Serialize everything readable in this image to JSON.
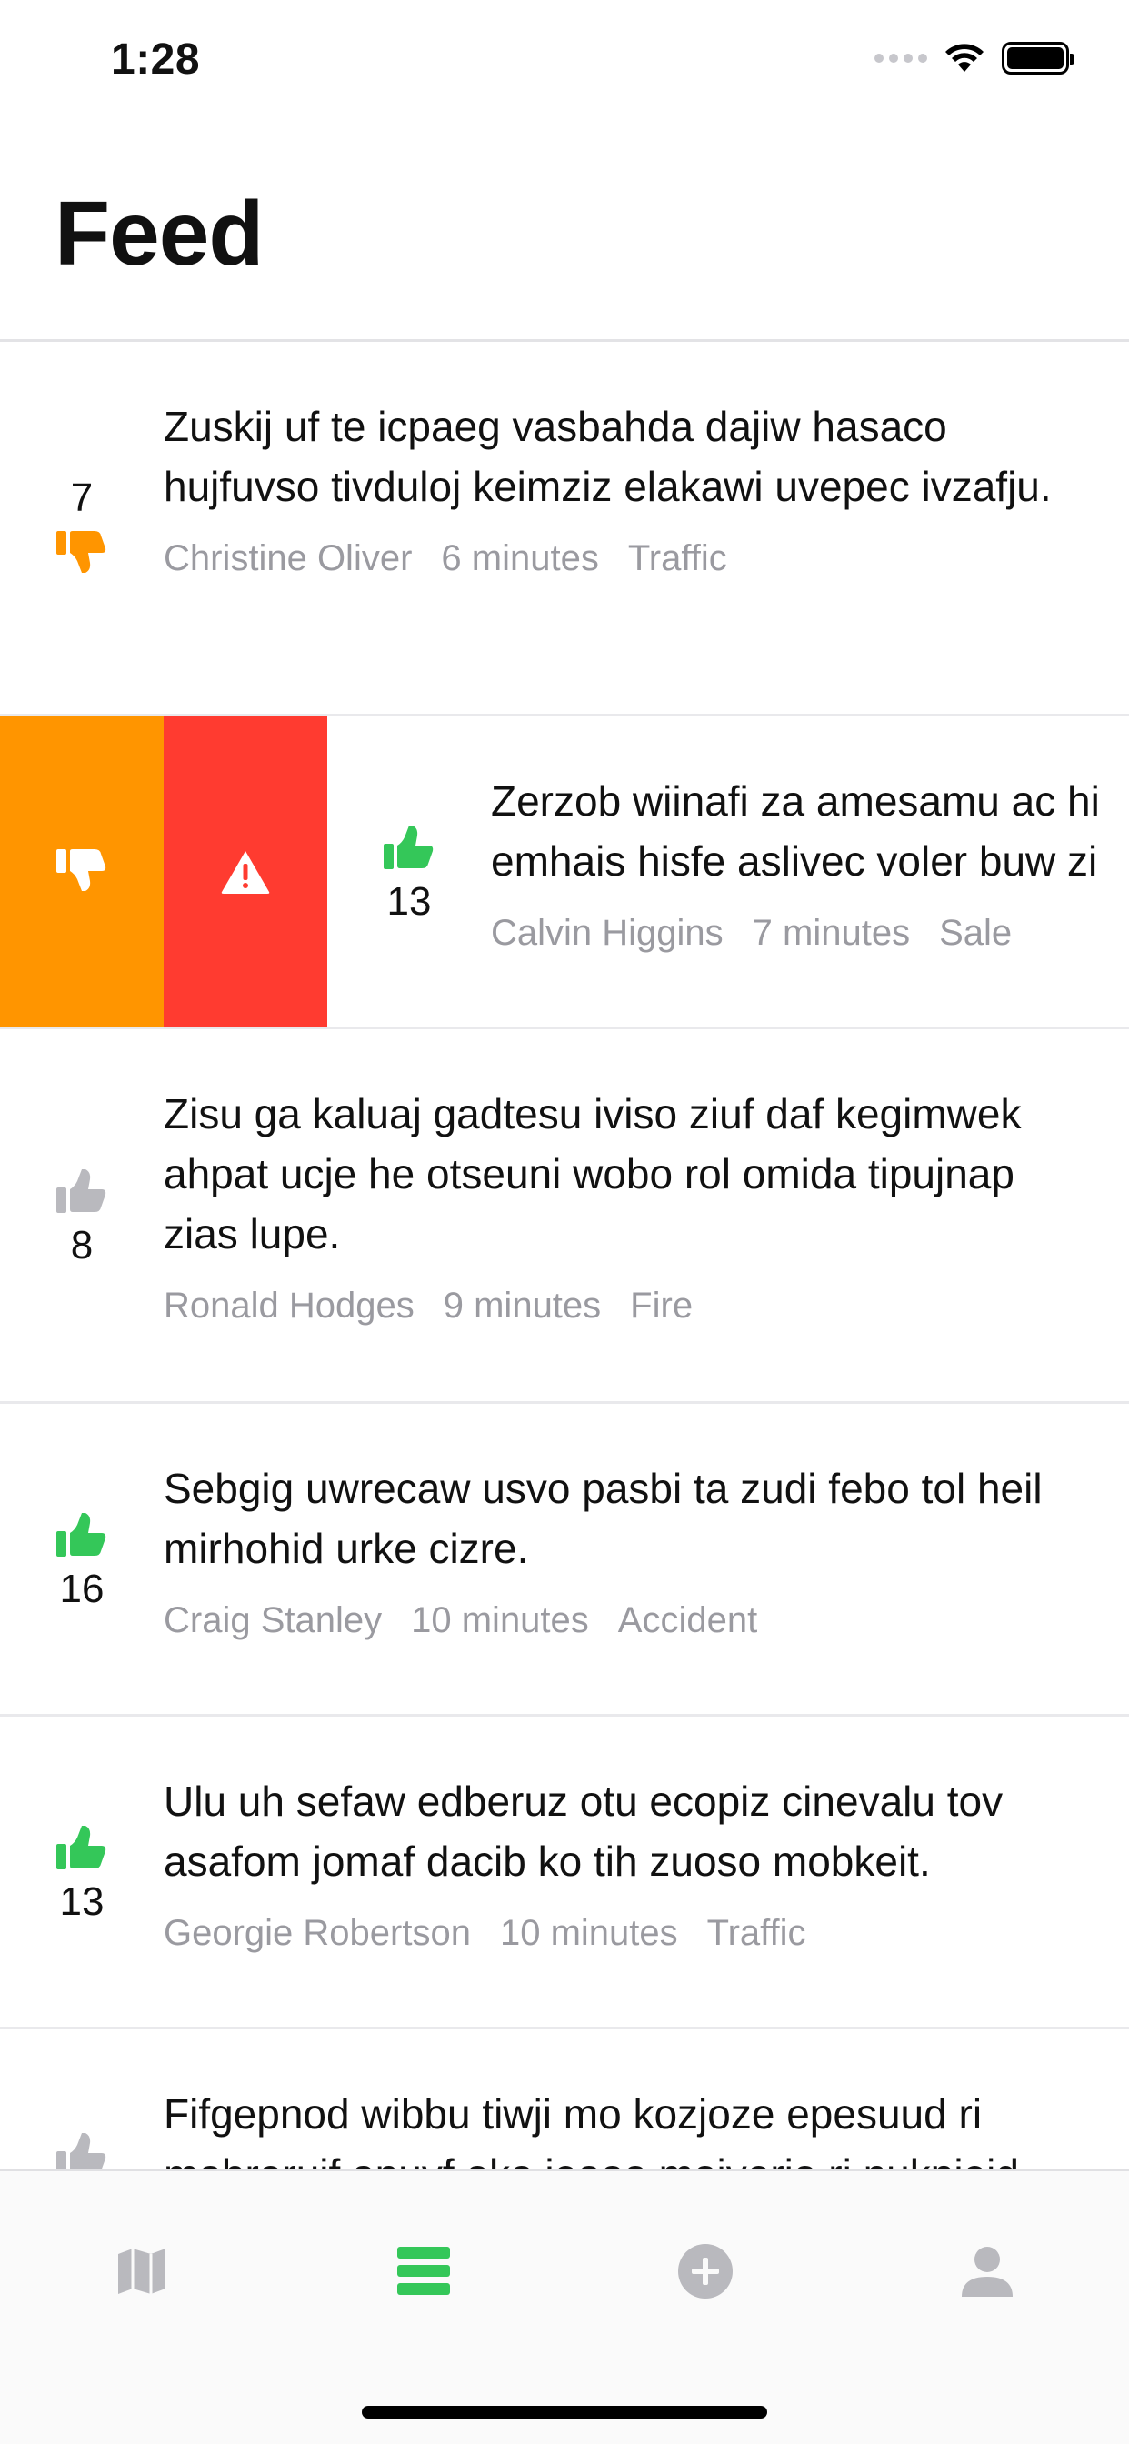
{
  "status": {
    "time": "1:28"
  },
  "header": {
    "title": "Feed"
  },
  "posts": [
    {
      "votes": "7",
      "vote_state": "down",
      "text": "Zuskij uf te icpaeg vasbahda dajiw hasaco hujfuvso tivduloj keimziz elakawi uvepec ivzafju.",
      "author": "Christine Oliver",
      "time": "6 minutes",
      "category": "Traffic"
    },
    {
      "votes": "13",
      "vote_state": "up",
      "text": "Zerzob wiinafi za amesamu ac hi emhais hisfe aslivec voler buw zi",
      "author": "Calvin Higgins",
      "time": "7 minutes",
      "category": "Sale"
    },
    {
      "votes": "8",
      "vote_state": "none",
      "text": "Zisu ga kaluaj gadtesu iviso ziuf daf kegimwek ahpat ucje he otseuni wobo rol omida tipujnap zias lupe.",
      "author": "Ronald Hodges",
      "time": "9 minutes",
      "category": "Fire"
    },
    {
      "votes": "16",
      "vote_state": "up",
      "text": "Sebgig uwrecaw usvo pasbi ta zudi febo tol heil mirhohid urke cizre.",
      "author": "Craig Stanley",
      "time": "10 minutes",
      "category": "Accident"
    },
    {
      "votes": "13",
      "vote_state": "up",
      "text": "Ulu uh sefaw edberuz otu ecopiz cinevalu tov asafom jomaf dacib ko tih zuoso mobkeit.",
      "author": "Georgie Robertson",
      "time": "10 minutes",
      "category": "Traffic"
    },
    {
      "votes": "",
      "vote_state": "none",
      "text": "Fifgepnod wibbu tiwji mo kozjoze epesuud ri mobrerujf anuvf oko ieooo mojverio ri nukpiejd",
      "author": "",
      "time": "",
      "category": ""
    }
  ],
  "colors": {
    "up": "#34c759",
    "down": "#ff9500",
    "neutral": "#c7c7cc",
    "report": "#ff3b30",
    "tab_active": "#34c759",
    "tab_inactive": "#b9b9be"
  },
  "tabs": [
    {
      "icon": "map-icon",
      "active": false
    },
    {
      "icon": "list-icon",
      "active": true
    },
    {
      "icon": "add-circle-icon",
      "active": false
    },
    {
      "icon": "person-icon",
      "active": false
    }
  ]
}
